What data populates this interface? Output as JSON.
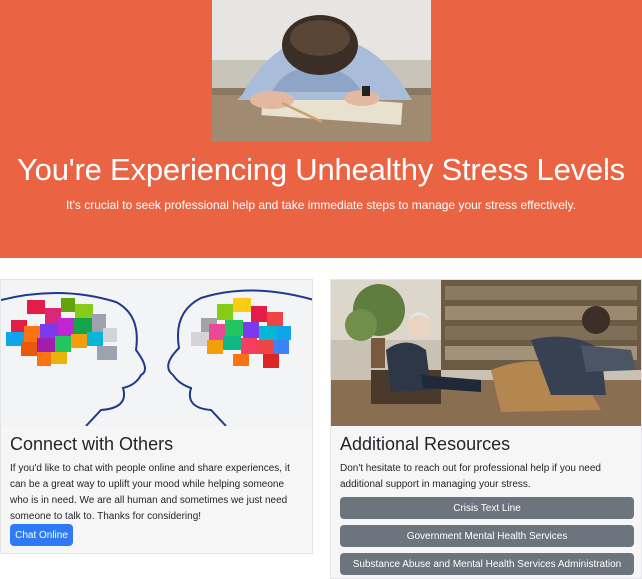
{
  "hero": {
    "image_alt": "Person with head resting on desk",
    "title": "You're Experiencing Unhealthy Stress Levels",
    "subtitle": "It's crucial to seek professional help and take immediate steps to manage your stress effectively.",
    "background_color": "#ea6444"
  },
  "cards": [
    {
      "image_alt": "Two head silhouettes with colorful puzzle-piece brains",
      "title": "Connect with Others",
      "text": "If you'd like to chat with people online and share experiences, it can be a great way to uplift your mood while helping someone who is in need. We are all human and sometimes we just need someone to talk to. Thanks for considering!",
      "button": "Chat Online",
      "button_color": "#2e79f6"
    },
    {
      "image_alt": "Therapy session in a room with bookshelves",
      "title": "Additional Resources",
      "text": "Don't hesitate to reach out for professional help if you need additional support in managing your stress.",
      "buttons": [
        "Crisis Text Line",
        "Government Mental Health Services",
        "Substance Abuse and Mental Health Services Administration"
      ],
      "button_color": "#6c757d"
    }
  ]
}
